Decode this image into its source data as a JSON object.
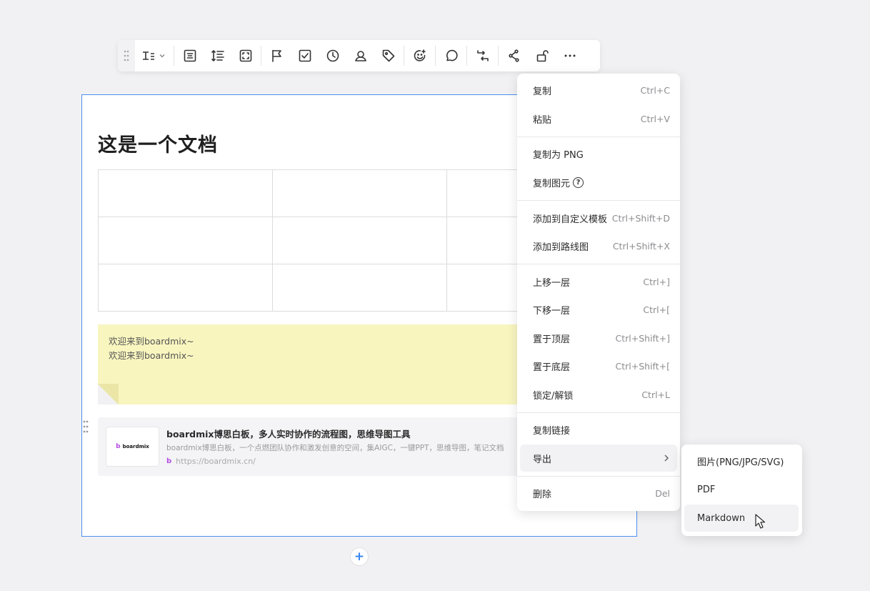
{
  "toolbar": {
    "items": [
      {
        "name": "text-style-icon"
      },
      {
        "name": "align-center-icon"
      },
      {
        "name": "line-height-icon"
      },
      {
        "name": "fit-frame-icon"
      },
      {
        "name": "flag-icon"
      },
      {
        "name": "checkbox-icon"
      },
      {
        "name": "clock-icon"
      },
      {
        "name": "mention-user-icon"
      },
      {
        "name": "tag-icon"
      },
      {
        "name": "emoji-add-icon"
      },
      {
        "name": "comment-icon"
      },
      {
        "name": "convert-icon"
      },
      {
        "name": "connector-icon"
      },
      {
        "name": "unlock-icon"
      },
      {
        "name": "more-icon"
      }
    ]
  },
  "document": {
    "title": "这是一个文档",
    "sticky_lines": [
      "欢迎来到boardmix~",
      "欢迎来到boardmix~"
    ],
    "link_card": {
      "logo_text": "boardmix",
      "title": "boardmix博思白板，多人实时协作的流程图，思维导图工具",
      "description": "boardmix博思白板，一个点燃团队协作和激发创意的空间，集AIGC，一键PPT，思维导图，笔记文档",
      "url": "https://boardmix.cn/"
    }
  },
  "context_menu": {
    "items": [
      {
        "label": "复制",
        "shortcut": "Ctrl+C"
      },
      {
        "label": "粘贴",
        "shortcut": "Ctrl+V"
      },
      {
        "label": "复制为 PNG",
        "shortcut": ""
      },
      {
        "label": "复制图元",
        "shortcut": ""
      },
      {
        "label": "添加到自定义模板",
        "shortcut": "Ctrl+Shift+D"
      },
      {
        "label": "添加到路线图",
        "shortcut": "Ctrl+Shift+X"
      },
      {
        "label": "上移一层",
        "shortcut": "Ctrl+]"
      },
      {
        "label": "下移一层",
        "shortcut": "Ctrl+["
      },
      {
        "label": "置于顶层",
        "shortcut": "Ctrl+Shift+]"
      },
      {
        "label": "置于底层",
        "shortcut": "Ctrl+Shift+["
      },
      {
        "label": "锁定/解锁",
        "shortcut": "Ctrl+L"
      },
      {
        "label": "复制链接",
        "shortcut": ""
      },
      {
        "label": "导出",
        "shortcut": ""
      },
      {
        "label": "删除",
        "shortcut": "Del"
      }
    ]
  },
  "export_submenu": {
    "items": [
      "图片(PNG/JPG/SVG)",
      "PDF",
      "Markdown"
    ],
    "hovered": "Markdown"
  },
  "colors": {
    "frame_border": "#4a8ff0",
    "sticky": "#f8f5bf",
    "accent": "#3a86f0"
  }
}
